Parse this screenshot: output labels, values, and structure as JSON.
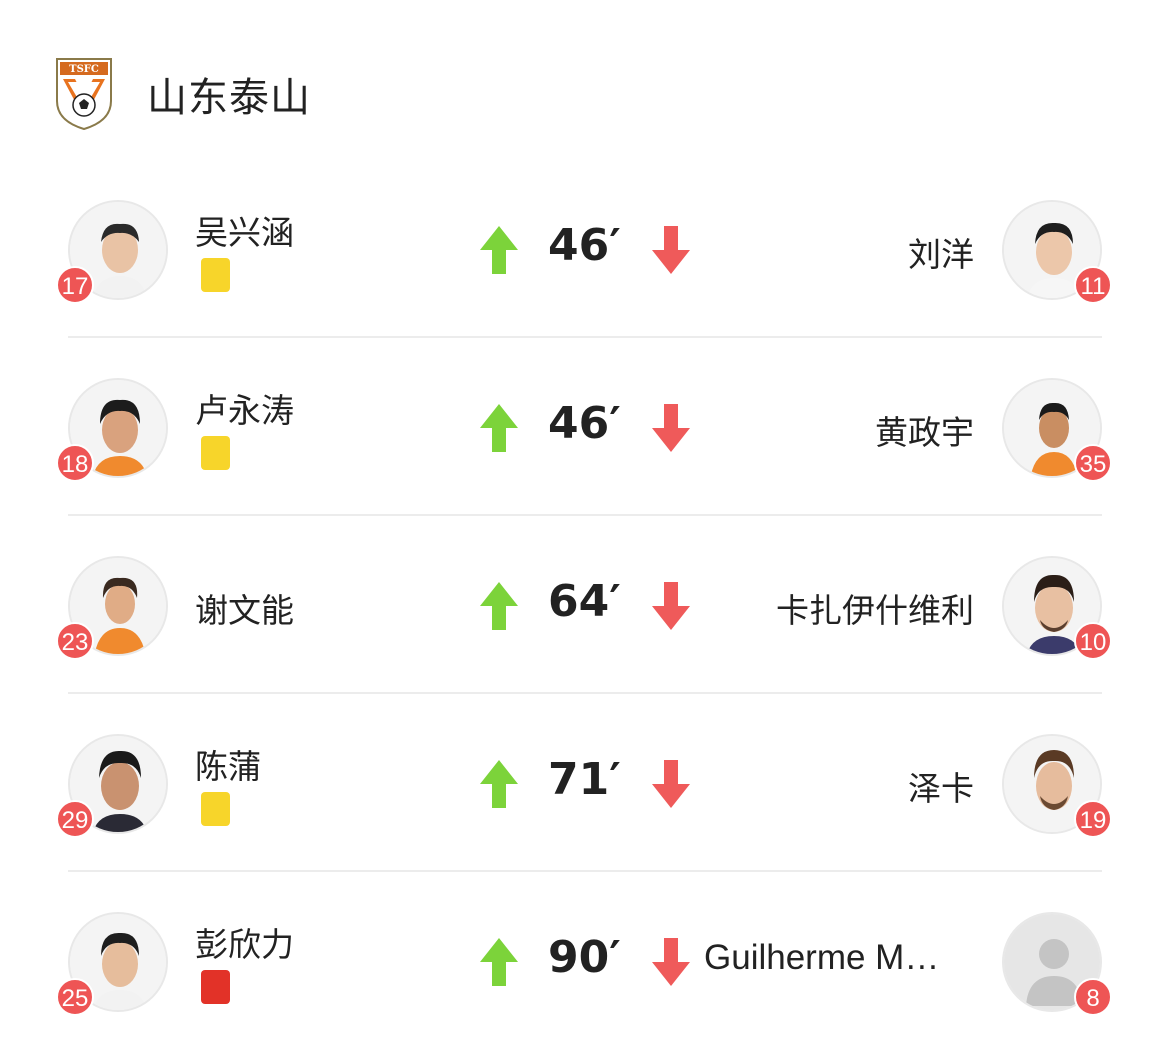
{
  "team": {
    "name": "山东泰山",
    "logo_text": "TSFC"
  },
  "substitutions": [
    {
      "in_name": "吴兴涵",
      "in_number": "17",
      "card": "yellow",
      "minute": "46′",
      "out_name": "刘洋",
      "out_number": "11"
    },
    {
      "in_name": "卢永涛",
      "in_number": "18",
      "card": "yellow",
      "minute": "46′",
      "out_name": "黄政宇",
      "out_number": "35"
    },
    {
      "in_name": "谢文能",
      "in_number": "23",
      "card": "",
      "minute": "64′",
      "out_name": "卡扎伊什维利",
      "out_number": "10"
    },
    {
      "in_name": "陈蒲",
      "in_number": "29",
      "card": "yellow",
      "minute": "71′",
      "out_name": "泽卡",
      "out_number": "19"
    },
    {
      "in_name": "彭欣力",
      "in_number": "25",
      "card": "red",
      "minute": "90′",
      "out_name": "Guilherme M…",
      "out_number": "8"
    }
  ],
  "colors": {
    "arrow_up": "#7cd33a",
    "arrow_down": "#ef5a5a",
    "number_badge": "#ee5555",
    "yellow_card": "#f7d52a",
    "red_card": "#e23228"
  }
}
